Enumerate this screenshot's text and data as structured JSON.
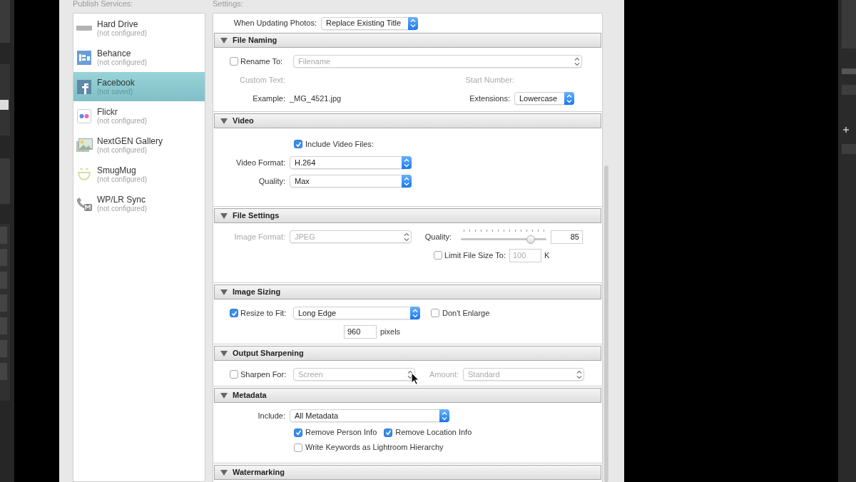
{
  "publish_services": {
    "label": "Publish Services:",
    "items": [
      {
        "name": "Hard Drive",
        "status": "(not configured)",
        "selected": false
      },
      {
        "name": "Behance",
        "status": "(not configured)",
        "selected": false
      },
      {
        "name": "Facebook",
        "status": "(not saved)",
        "selected": true
      },
      {
        "name": "Flickr",
        "status": "(not configured)",
        "selected": false
      },
      {
        "name": "NextGEN Gallery",
        "status": "(not configured)",
        "selected": false
      },
      {
        "name": "SmugMug",
        "status": "(not configured)",
        "selected": false
      },
      {
        "name": "WP/LR Sync",
        "status": "(not configured)",
        "selected": false
      }
    ]
  },
  "settings": {
    "label": "Settings:",
    "update_row": {
      "label": "When Updating Photos:",
      "value": "Replace Existing Title"
    },
    "sections": [
      {
        "kind": "file_naming",
        "title": "File Naming",
        "expanded": true,
        "rename": {
          "label": "Rename To:",
          "checked": false,
          "value": "Filename",
          "disabled": true
        },
        "custom_text": {
          "label": "Custom Text:",
          "disabled": true
        },
        "start_number": {
          "label": "Start Number:",
          "disabled": true
        },
        "example": {
          "label": "Example:",
          "value": "_MG_4521.jpg"
        },
        "extensions": {
          "label": "Extensions:",
          "value": "Lowercase"
        }
      },
      {
        "kind": "video",
        "title": "Video",
        "expanded": true,
        "include": {
          "label": "Include Video Files:",
          "checked": true
        },
        "format": {
          "label": "Video Format:",
          "value": "H.264"
        },
        "quality": {
          "label": "Quality:",
          "value": "Max"
        }
      },
      {
        "kind": "file_settings",
        "title": "File Settings",
        "expanded": true,
        "image_format": {
          "label": "Image Format:",
          "value": "JPEG",
          "disabled": true
        },
        "quality": {
          "label": "Quality:",
          "level": 0.82,
          "value": "85"
        },
        "limit": {
          "label": "Limit File Size To:",
          "checked": false,
          "value": "100",
          "unit": "K",
          "disabled": true
        }
      },
      {
        "kind": "image_sizing",
        "title": "Image Sizing",
        "expanded": true,
        "resize": {
          "label": "Resize to Fit:",
          "checked": true,
          "value": "Long Edge"
        },
        "dont_enlarge": {
          "label": "Don't Enlarge",
          "checked": false
        },
        "size": {
          "value": "960",
          "unit": "pixels"
        }
      },
      {
        "kind": "output_sharpening",
        "title": "Output Sharpening",
        "expanded": true,
        "sharpen": {
          "label": "Sharpen For:",
          "checked": false,
          "value": "Screen",
          "disabled": true
        },
        "amount": {
          "label": "Amount:",
          "value": "Standard",
          "disabled": true
        }
      },
      {
        "kind": "metadata",
        "title": "Metadata",
        "expanded": true,
        "include": {
          "label": "Include:",
          "value": "All Metadata"
        },
        "options": [
          {
            "label": "Remove Person Info",
            "checked": true
          },
          {
            "label": "Remove Location Info",
            "checked": true
          },
          {
            "label": "Write Keywords as Lightroom Hierarchy",
            "checked": false
          }
        ]
      },
      {
        "kind": "watermarking",
        "title": "Watermarking",
        "expanded": true
      }
    ]
  }
}
